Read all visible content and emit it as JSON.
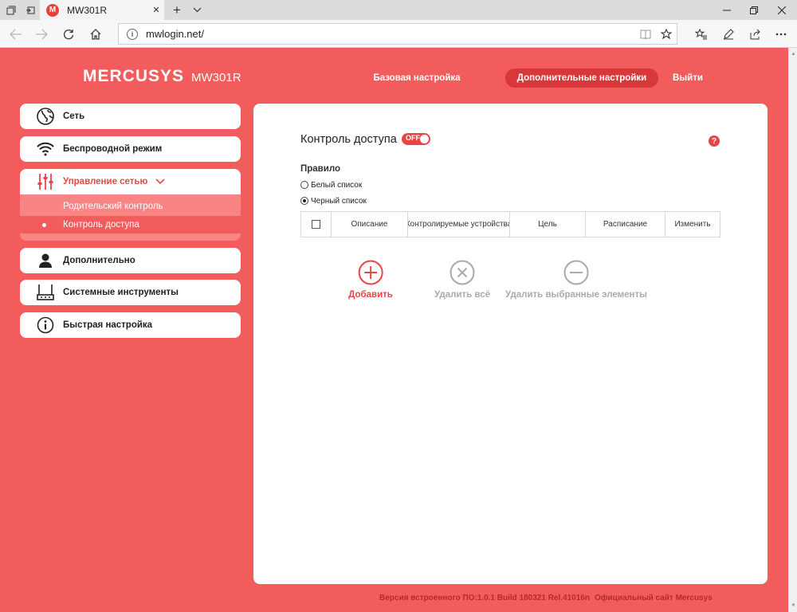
{
  "browser": {
    "tab_title": "MW301R",
    "favicon_letter": "M",
    "url": "mwlogin.net/"
  },
  "header": {
    "brand": "MERCUSYS",
    "model": "MW301R",
    "nav": {
      "basic": "Базовая настройка",
      "advanced": "Дополнительные настройки",
      "logout": "Выйти"
    }
  },
  "sidebar": {
    "items": [
      {
        "label": "Сеть",
        "icon": "globe-icon"
      },
      {
        "label": "Беспроводной режим",
        "icon": "wifi-icon"
      },
      {
        "label": "Управление сетью",
        "icon": "sliders-icon"
      },
      {
        "label": "Дополнительно",
        "icon": "user-icon"
      },
      {
        "label": "Системные инструменты",
        "icon": "router-icon"
      },
      {
        "label": "Быстрая настройка",
        "icon": "info-icon"
      }
    ],
    "submenu": [
      "Родительский контроль",
      "Контроль доступа"
    ]
  },
  "main": {
    "title": "Контроль доступа",
    "toggle_label": "OFF",
    "help": "?",
    "rule_label": "Правило",
    "rules": [
      {
        "label": "Белый список",
        "checked": false
      },
      {
        "label": "Черный список",
        "checked": true
      }
    ],
    "table_headers": [
      "Описание",
      "Контролируемые устройства",
      "Цель",
      "Расписание",
      "Изменить"
    ],
    "actions": {
      "add": "Добавить",
      "delete_all": "Удалить всё",
      "delete_selected": "Удалить выбранные элементы"
    }
  },
  "footer": {
    "firmware": "Версия встроенного ПО:1.0.1 Build 180321 Rel.41016n",
    "site": "Официальный сайт Mercusys"
  },
  "colors": {
    "brand": "#f25c5c",
    "accent": "#e84646",
    "active_nav": "#d9383a"
  }
}
